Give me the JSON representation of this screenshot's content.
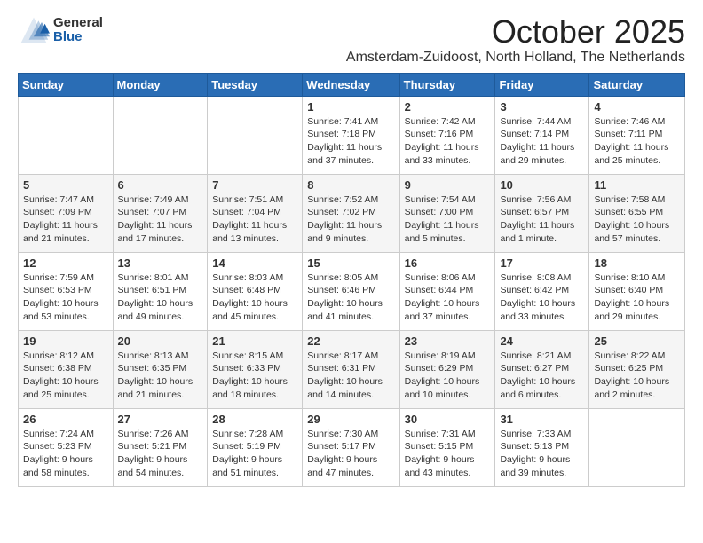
{
  "header": {
    "logo_general": "General",
    "logo_blue": "Blue",
    "month": "October 2025",
    "location": "Amsterdam-Zuidoost, North Holland, The Netherlands"
  },
  "weekdays": [
    "Sunday",
    "Monday",
    "Tuesday",
    "Wednesday",
    "Thursday",
    "Friday",
    "Saturday"
  ],
  "weeks": [
    [
      {
        "day": "",
        "info": ""
      },
      {
        "day": "",
        "info": ""
      },
      {
        "day": "",
        "info": ""
      },
      {
        "day": "1",
        "info": "Sunrise: 7:41 AM\nSunset: 7:18 PM\nDaylight: 11 hours and 37 minutes."
      },
      {
        "day": "2",
        "info": "Sunrise: 7:42 AM\nSunset: 7:16 PM\nDaylight: 11 hours and 33 minutes."
      },
      {
        "day": "3",
        "info": "Sunrise: 7:44 AM\nSunset: 7:14 PM\nDaylight: 11 hours and 29 minutes."
      },
      {
        "day": "4",
        "info": "Sunrise: 7:46 AM\nSunset: 7:11 PM\nDaylight: 11 hours and 25 minutes."
      }
    ],
    [
      {
        "day": "5",
        "info": "Sunrise: 7:47 AM\nSunset: 7:09 PM\nDaylight: 11 hours and 21 minutes."
      },
      {
        "day": "6",
        "info": "Sunrise: 7:49 AM\nSunset: 7:07 PM\nDaylight: 11 hours and 17 minutes."
      },
      {
        "day": "7",
        "info": "Sunrise: 7:51 AM\nSunset: 7:04 PM\nDaylight: 11 hours and 13 minutes."
      },
      {
        "day": "8",
        "info": "Sunrise: 7:52 AM\nSunset: 7:02 PM\nDaylight: 11 hours and 9 minutes."
      },
      {
        "day": "9",
        "info": "Sunrise: 7:54 AM\nSunset: 7:00 PM\nDaylight: 11 hours and 5 minutes."
      },
      {
        "day": "10",
        "info": "Sunrise: 7:56 AM\nSunset: 6:57 PM\nDaylight: 11 hours and 1 minute."
      },
      {
        "day": "11",
        "info": "Sunrise: 7:58 AM\nSunset: 6:55 PM\nDaylight: 10 hours and 57 minutes."
      }
    ],
    [
      {
        "day": "12",
        "info": "Sunrise: 7:59 AM\nSunset: 6:53 PM\nDaylight: 10 hours and 53 minutes."
      },
      {
        "day": "13",
        "info": "Sunrise: 8:01 AM\nSunset: 6:51 PM\nDaylight: 10 hours and 49 minutes."
      },
      {
        "day": "14",
        "info": "Sunrise: 8:03 AM\nSunset: 6:48 PM\nDaylight: 10 hours and 45 minutes."
      },
      {
        "day": "15",
        "info": "Sunrise: 8:05 AM\nSunset: 6:46 PM\nDaylight: 10 hours and 41 minutes."
      },
      {
        "day": "16",
        "info": "Sunrise: 8:06 AM\nSunset: 6:44 PM\nDaylight: 10 hours and 37 minutes."
      },
      {
        "day": "17",
        "info": "Sunrise: 8:08 AM\nSunset: 6:42 PM\nDaylight: 10 hours and 33 minutes."
      },
      {
        "day": "18",
        "info": "Sunrise: 8:10 AM\nSunset: 6:40 PM\nDaylight: 10 hours and 29 minutes."
      }
    ],
    [
      {
        "day": "19",
        "info": "Sunrise: 8:12 AM\nSunset: 6:38 PM\nDaylight: 10 hours and 25 minutes."
      },
      {
        "day": "20",
        "info": "Sunrise: 8:13 AM\nSunset: 6:35 PM\nDaylight: 10 hours and 21 minutes."
      },
      {
        "day": "21",
        "info": "Sunrise: 8:15 AM\nSunset: 6:33 PM\nDaylight: 10 hours and 18 minutes."
      },
      {
        "day": "22",
        "info": "Sunrise: 8:17 AM\nSunset: 6:31 PM\nDaylight: 10 hours and 14 minutes."
      },
      {
        "day": "23",
        "info": "Sunrise: 8:19 AM\nSunset: 6:29 PM\nDaylight: 10 hours and 10 minutes."
      },
      {
        "day": "24",
        "info": "Sunrise: 8:21 AM\nSunset: 6:27 PM\nDaylight: 10 hours and 6 minutes."
      },
      {
        "day": "25",
        "info": "Sunrise: 8:22 AM\nSunset: 6:25 PM\nDaylight: 10 hours and 2 minutes."
      }
    ],
    [
      {
        "day": "26",
        "info": "Sunrise: 7:24 AM\nSunset: 5:23 PM\nDaylight: 9 hours and 58 minutes."
      },
      {
        "day": "27",
        "info": "Sunrise: 7:26 AM\nSunset: 5:21 PM\nDaylight: 9 hours and 54 minutes."
      },
      {
        "day": "28",
        "info": "Sunrise: 7:28 AM\nSunset: 5:19 PM\nDaylight: 9 hours and 51 minutes."
      },
      {
        "day": "29",
        "info": "Sunrise: 7:30 AM\nSunset: 5:17 PM\nDaylight: 9 hours and 47 minutes."
      },
      {
        "day": "30",
        "info": "Sunrise: 7:31 AM\nSunset: 5:15 PM\nDaylight: 9 hours and 43 minutes."
      },
      {
        "day": "31",
        "info": "Sunrise: 7:33 AM\nSunset: 5:13 PM\nDaylight: 9 hours and 39 minutes."
      },
      {
        "day": "",
        "info": ""
      }
    ]
  ]
}
